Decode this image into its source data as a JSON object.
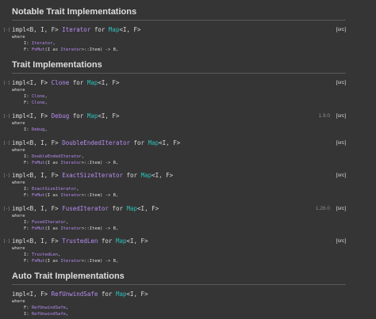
{
  "headings": {
    "notable": "Notable Trait Implementations",
    "trait_impls": "Trait Implementations",
    "auto": "Auto Trait Implementations"
  },
  "common": {
    "where": "where",
    "src": "[src]",
    "toggle": "[-]"
  },
  "notable": {
    "kw": "impl<B, I, F> ",
    "trait": "Iterator",
    "for": " for ",
    "struct": "Map",
    "gen": "<I, F>",
    "b1_pre": "I: ",
    "b1_trait": "Iterator",
    "b1_post": ",",
    "b2_pre": "F: ",
    "b2_trait": "FnMut",
    "b2_mid": "(I as ",
    "b2_trait2": "Iterator",
    "b2_post": ">::Item) -> B,"
  },
  "clone": {
    "kw": "impl<I, F> ",
    "trait": "Clone",
    "for": " for ",
    "struct": "Map",
    "gen": "<I, F>",
    "b1_pre": "I: ",
    "b1_trait": "Clone",
    "b1_post": ",",
    "b2_pre": "F: ",
    "b2_trait": "Clone",
    "b2_post": ","
  },
  "debug": {
    "kw": "impl<I, F> ",
    "trait": "Debug",
    "for": " for ",
    "struct": "Map",
    "gen": "<I, F>",
    "since": "1.9.0",
    "b1_pre": "I: ",
    "b1_trait": "Debug",
    "b1_post": ","
  },
  "dei": {
    "kw": "impl<B, I, F> ",
    "trait": "DoubleEndedIterator",
    "for": " for ",
    "struct": "Map",
    "gen": "<I, F>",
    "b1_pre": "I: ",
    "b1_trait": "DoubleEndedIterator",
    "b1_post": ",",
    "b2_pre": "F: ",
    "b2_trait": "FnMut",
    "b2_mid": "(I as ",
    "b2_trait2": "Iterator",
    "b2_post": ">::Item) -> B,"
  },
  "esi": {
    "kw": "impl<B, I, F> ",
    "trait": "ExactSizeIterator",
    "for": " for ",
    "struct": "Map",
    "gen": "<I, F>",
    "b1_pre": "I: ",
    "b1_trait": "ExactSizeIterator",
    "b1_post": ",",
    "b2_pre": "F: ",
    "b2_trait": "FnMut",
    "b2_mid": "(I as ",
    "b2_trait2": "Iterator",
    "b2_post": ">::Item) -> B,"
  },
  "fused": {
    "kw": "impl<B, I, F> ",
    "trait": "FusedIterator",
    "for": " for ",
    "struct": "Map",
    "gen": "<I, F>",
    "since": "1.26.0",
    "b1_pre": "I: ",
    "b1_trait": "FusedIterator",
    "b1_post": ",",
    "b2_pre": "F: ",
    "b2_trait": "FnMut",
    "b2_mid": "(I as ",
    "b2_trait2": "Iterator",
    "b2_post": ">::Item) -> B,"
  },
  "trusted": {
    "kw": "impl<B, I, F> ",
    "trait": "TrustedLen",
    "for": " for ",
    "struct": "Map",
    "gen": "<I, F>",
    "b1_pre": "I: ",
    "b1_trait": "TrustedLen",
    "b1_post": ",",
    "b2_pre": "F: ",
    "b2_trait": "FnMut",
    "b2_mid": "(I as ",
    "b2_trait2": "Iterator",
    "b2_post": ">::Item) -> B,"
  },
  "refunwind": {
    "kw": "impl<I, F> ",
    "trait": "RefUnwindSafe",
    "for": " for ",
    "struct": "Map",
    "gen": "<I, F>",
    "b1_pre": "F: ",
    "b1_trait": "RefUnwindSafe",
    "b1_post": ",",
    "b2_pre": "I: ",
    "b2_trait": "RefUnwindSafe",
    "b2_post": ","
  }
}
